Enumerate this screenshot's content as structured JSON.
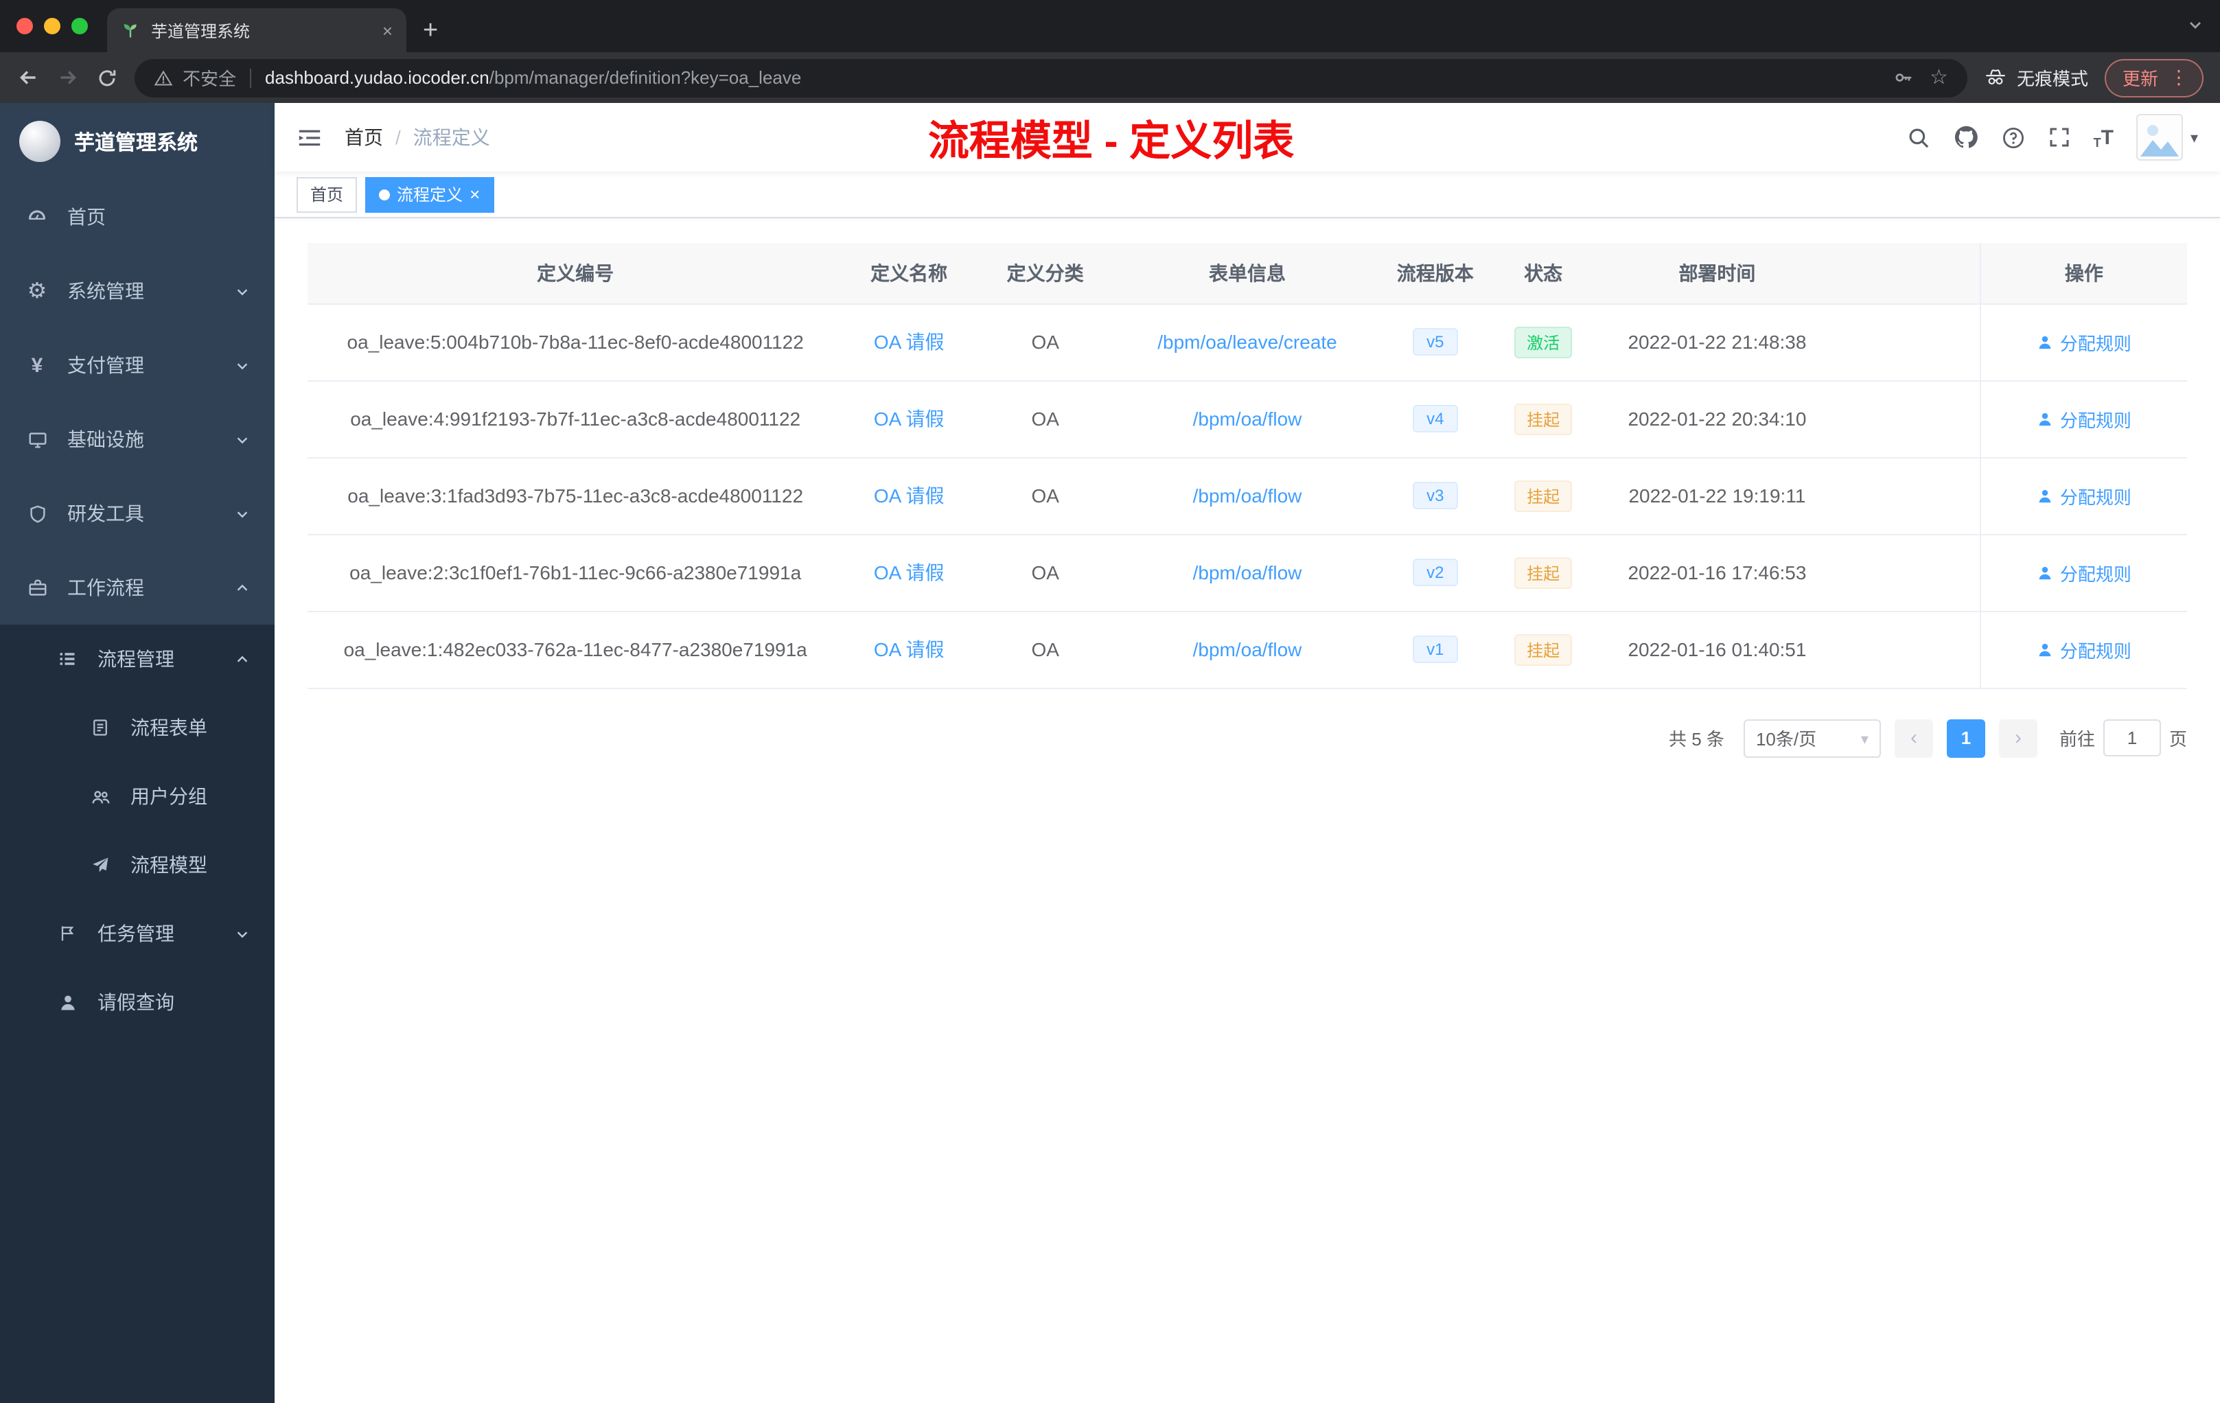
{
  "browser": {
    "tab": {
      "title": "芋道管理系统"
    },
    "toolbar": {
      "security_label": "不安全",
      "url_host": "dashboard.yudao.iocoder.cn",
      "url_path": "/bpm/manager/definition?key=oa_leave",
      "incognito_label": "无痕模式",
      "update_label": "更新"
    }
  },
  "sidebar": {
    "logo_title": "芋道管理系统",
    "items": [
      {
        "label": "首页"
      },
      {
        "label": "系统管理"
      },
      {
        "label": "支付管理"
      },
      {
        "label": "基础设施"
      },
      {
        "label": "研发工具"
      },
      {
        "label": "工作流程"
      },
      {
        "label": "流程管理"
      },
      {
        "label": "流程表单"
      },
      {
        "label": "用户分组"
      },
      {
        "label": "流程模型"
      },
      {
        "label": "任务管理"
      },
      {
        "label": "请假查询"
      }
    ]
  },
  "header": {
    "breadcrumb": {
      "home": "首页",
      "separator": "/",
      "current": "流程定义"
    },
    "annotation": "流程模型 - 定义列表"
  },
  "tags": {
    "home": "首页",
    "active": "流程定义"
  },
  "table": {
    "columns": [
      "定义编号",
      "定义名称",
      "定义分类",
      "表单信息",
      "流程版本",
      "状态",
      "部署时间",
      "操作"
    ],
    "rows": [
      {
        "id": "oa_leave:5:004b710b-7b8a-11ec-8ef0-acde48001122",
        "name": "OA 请假",
        "category": "OA",
        "form": "/bpm/oa/leave/create",
        "version": "v5",
        "status": "激活",
        "status_type": "active",
        "deploy_time": "2022-01-22 21:48:38",
        "action": "分配规则"
      },
      {
        "id": "oa_leave:4:991f2193-7b7f-11ec-a3c8-acde48001122",
        "name": "OA 请假",
        "category": "OA",
        "form": "/bpm/oa/flow",
        "version": "v4",
        "status": "挂起",
        "status_type": "suspended",
        "deploy_time": "2022-01-22 20:34:10",
        "action": "分配规则"
      },
      {
        "id": "oa_leave:3:1fad3d93-7b75-11ec-a3c8-acde48001122",
        "name": "OA 请假",
        "category": "OA",
        "form": "/bpm/oa/flow",
        "version": "v3",
        "status": "挂起",
        "status_type": "suspended",
        "deploy_time": "2022-01-22 19:19:11",
        "action": "分配规则"
      },
      {
        "id": "oa_leave:2:3c1f0ef1-76b1-11ec-9c66-a2380e71991a",
        "name": "OA 请假",
        "category": "OA",
        "form": "/bpm/oa/flow",
        "version": "v2",
        "status": "挂起",
        "status_type": "suspended",
        "deploy_time": "2022-01-16 17:46:53",
        "action": "分配规则"
      },
      {
        "id": "oa_leave:1:482ec033-762a-11ec-8477-a2380e71991a",
        "name": "OA 请假",
        "category": "OA",
        "form": "/bpm/oa/flow",
        "version": "v1",
        "status": "挂起",
        "status_type": "suspended",
        "deploy_time": "2022-01-16 01:40:51",
        "action": "分配规则"
      }
    ]
  },
  "pagination": {
    "total": "共 5 条",
    "page_size": "10条/页",
    "prev": "‹",
    "page": "1",
    "next": "›",
    "goto_label": "前往",
    "goto_value": "1",
    "unit": "页"
  },
  "colors": {
    "accent": "#409eff",
    "annotation_red": "#f20d0d",
    "status_active": "#13ce66",
    "status_suspended": "#e6a23c",
    "sidebar_bg": "#304156",
    "submenu_bg": "#1f2d3d"
  }
}
